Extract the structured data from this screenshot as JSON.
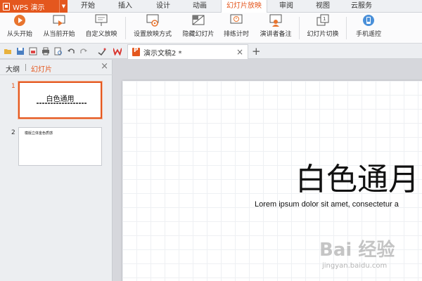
{
  "app": {
    "name": "WPS 演示"
  },
  "menu": {
    "tabs": [
      {
        "label": "开始"
      },
      {
        "label": "插入"
      },
      {
        "label": "设计"
      },
      {
        "label": "动画"
      },
      {
        "label": "幻灯片放映",
        "active": true
      },
      {
        "label": "审阅"
      },
      {
        "label": "视图"
      },
      {
        "label": "云服务"
      }
    ]
  },
  "ribbon": {
    "from_start": "从头开始",
    "from_current": "从当前开始",
    "custom_show": "自定义放映",
    "setup_show": "设置放映方式",
    "hide_slide": "隐藏幻灯片",
    "rehearse": "排练计时",
    "speaker_notes": "演讲者备注",
    "transition": "幻灯片切换",
    "phone_remote": "手机遥控"
  },
  "document": {
    "tab_title": "演示文稿2 *"
  },
  "panel": {
    "tab_outline": "大纲",
    "tab_slides": "幻灯片",
    "slides": [
      {
        "number": "1",
        "title": "白色通用"
      },
      {
        "number": "2",
        "text": "模版立体金色质感"
      }
    ]
  },
  "slide": {
    "title": "白色通月",
    "subtitle": "Lorem ipsum dolor sit amet, consectetur a"
  },
  "watermark": {
    "main": "Bai 经验",
    "sub": "jingyan.baidu.com"
  },
  "colors": {
    "accent": "#e4571e",
    "toolbar_bg": "#fbfbfc"
  }
}
